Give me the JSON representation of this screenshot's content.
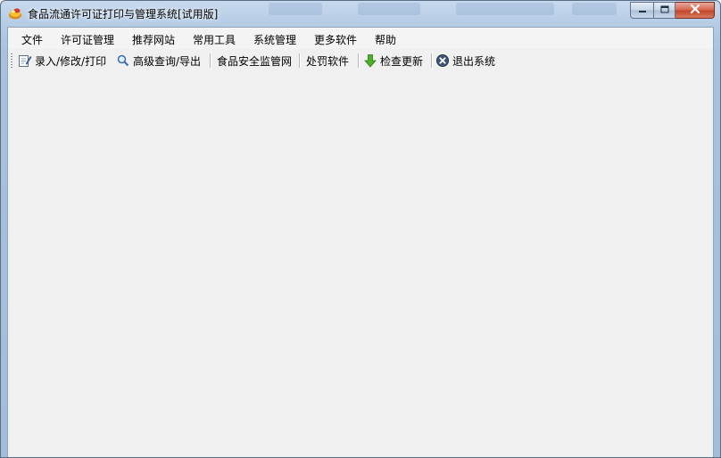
{
  "window": {
    "title": "食品流通许可证打印与管理系统[试用版]",
    "controls": {
      "minimize": "minimize-icon",
      "maximize": "maximize-icon",
      "close": "close-icon"
    }
  },
  "menu": {
    "items": [
      "文件",
      "许可证管理",
      "推荐网站",
      "常用工具",
      "系统管理",
      "更多软件",
      "帮助"
    ]
  },
  "toolbar": {
    "entry_print": "录入/修改/打印",
    "advanced_query": "高级查询/导出",
    "food_safety_site": "食品安全监管网",
    "penalty_software": "处罚软件",
    "check_update": "检查更新",
    "exit_system": "退出系统",
    "icons": {
      "entry_print": "edit-document-icon",
      "advanced_query": "magnifier-icon",
      "check_update": "green-down-arrow-icon",
      "exit_system": "circle-x-icon"
    }
  },
  "colors": {
    "frame": "#a9c1dd",
    "client_bg": "#f0f0f0",
    "close_button": "#c2462b"
  }
}
